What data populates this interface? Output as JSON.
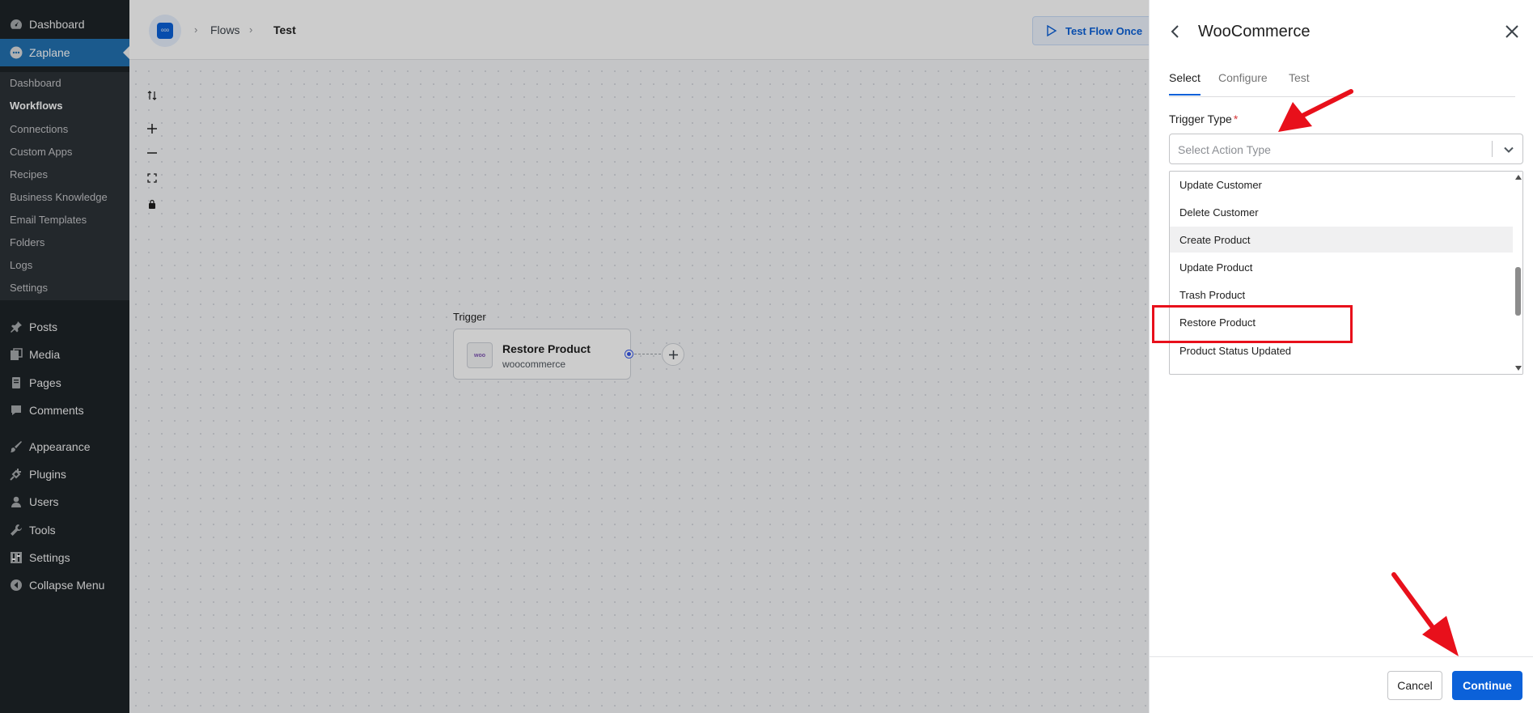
{
  "colors": {
    "wp_sidebar_bg": "#1d2327",
    "wp_active": "#2271b1",
    "accent": "#0b61d9",
    "annotation_red": "#e8101b"
  },
  "wp_menu": {
    "top_items": [
      {
        "label": "Dashboard",
        "icon": "dashboard-icon"
      },
      {
        "label": "Zaplane",
        "icon": "zaplane-logo-icon"
      }
    ],
    "submenu": [
      "Dashboard",
      "Workflows",
      "Connections",
      "Custom Apps",
      "Recipes",
      "Business Knowledge",
      "Email Templates",
      "Folders",
      "Logs",
      "Settings"
    ],
    "items": [
      {
        "label": "Posts",
        "icon": "pushpin-icon"
      },
      {
        "label": "Media",
        "icon": "media-icon"
      },
      {
        "label": "Pages",
        "icon": "pages-icon"
      },
      {
        "label": "Comments",
        "icon": "comment-icon"
      },
      {
        "label": "Appearance",
        "icon": "paintbrush-icon"
      },
      {
        "label": "Plugins",
        "icon": "plugin-icon"
      },
      {
        "label": "Users",
        "icon": "user-icon"
      },
      {
        "label": "Tools",
        "icon": "wrench-icon"
      },
      {
        "label": "Settings",
        "icon": "settings-sliders-icon"
      },
      {
        "label": "Collapse Menu",
        "icon": "collapse-icon"
      }
    ]
  },
  "topbar": {
    "logo_text": "ooo",
    "breadcrumbs": [
      "Flows",
      "Test"
    ],
    "test_button": "Test Flow Once"
  },
  "canvas": {
    "controls": [
      "swap-icon",
      "zoom-in-icon",
      "zoom-out-icon",
      "fit-view-icon",
      "lock-icon"
    ],
    "trigger_label": "Trigger",
    "node": {
      "title": "Restore Product",
      "subtitle": "woocommerce",
      "icon_text": "woo"
    }
  },
  "panel": {
    "title": "WooCommerce",
    "tabs": [
      "Select",
      "Configure",
      "Test"
    ],
    "active_tab": "Select",
    "field_label": "Trigger Type",
    "required_mark": "*",
    "select_placeholder": "Select Action Type",
    "options": [
      "Update Customer",
      "Delete Customer",
      "Create Product",
      "Update Product",
      "Trash Product",
      "Restore Product",
      "Product Status Updated"
    ],
    "hovered_option": "Create Product",
    "highlighted_option": "Restore Product",
    "cancel": "Cancel",
    "continue": "Continue"
  }
}
